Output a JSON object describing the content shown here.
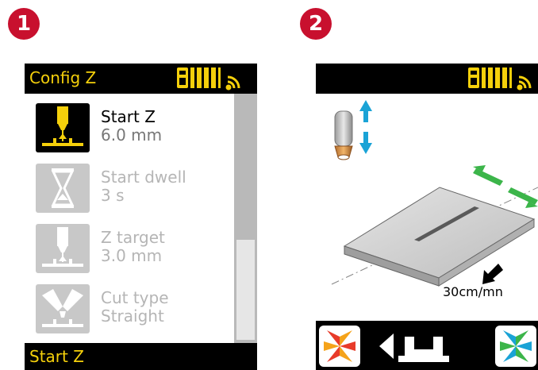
{
  "badges": {
    "step1": "1",
    "step2": "2"
  },
  "screen1": {
    "header_title": "Config Z",
    "menu": [
      {
        "label": "Start Z",
        "value": "6.0 mm",
        "icon": "torch-height-icon",
        "active": true
      },
      {
        "label": "Start dwell",
        "value": "3 s",
        "icon": "hourglass-icon",
        "active": false
      },
      {
        "label": "Z target",
        "value": "3.0 mm",
        "icon": "torch-height-icon",
        "active": false
      },
      {
        "label": "Cut type",
        "value": "Straight",
        "icon": "cut-type-icon",
        "active": false
      }
    ],
    "footer_label": "Start Z"
  },
  "screen2": {
    "speed_label": "30cm/mn"
  },
  "colors": {
    "accent_yellow": "#f5d00b",
    "badge_red": "#c8102e",
    "arrow_blue": "#1aa3d6",
    "arrow_green": "#3cb54a"
  }
}
